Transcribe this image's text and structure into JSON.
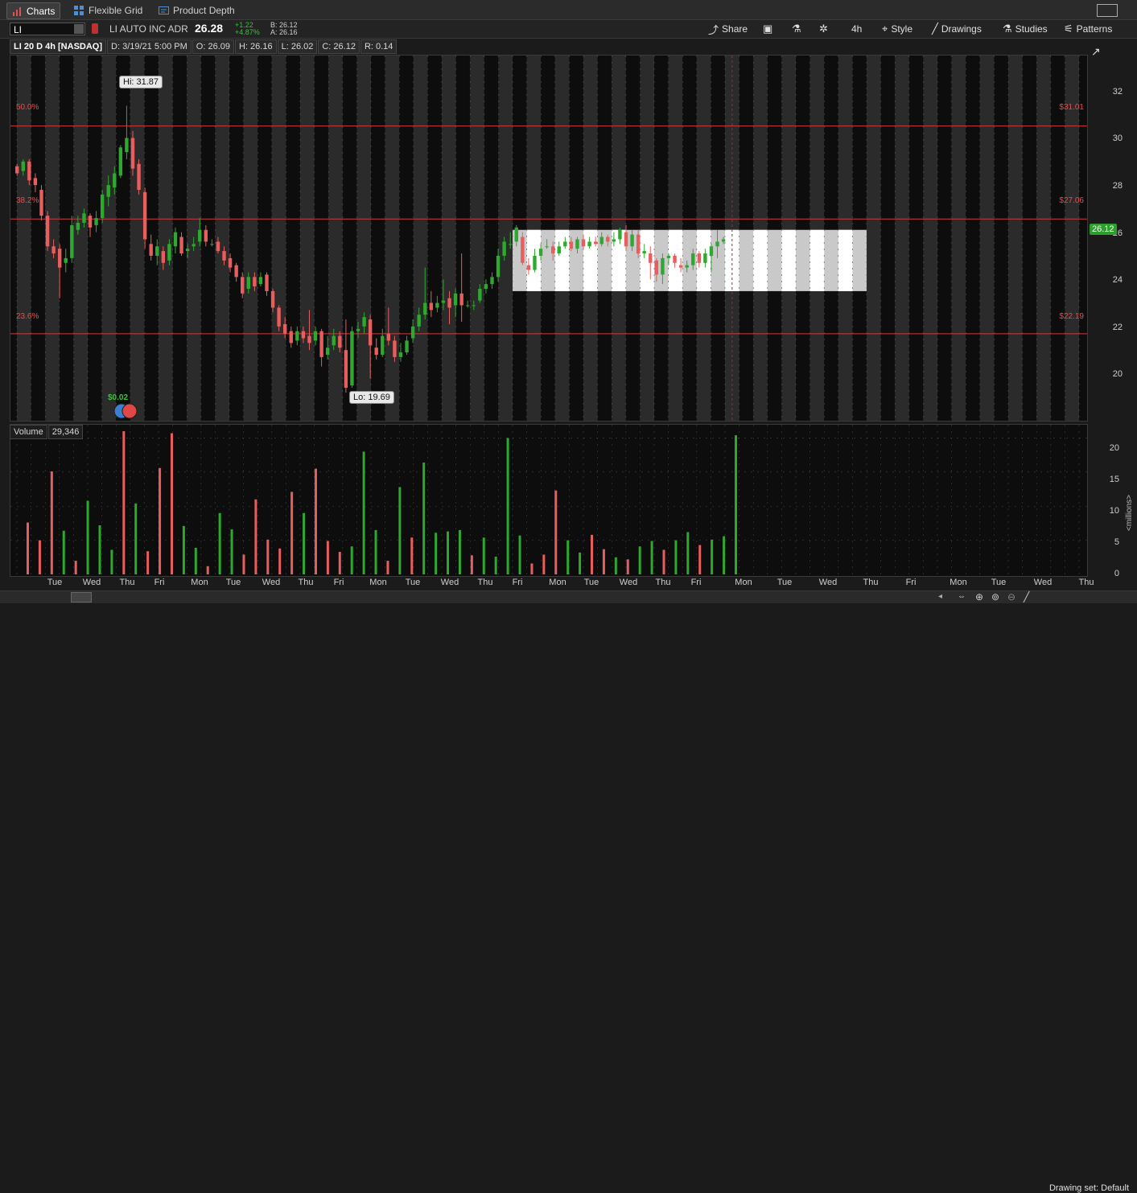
{
  "tabs": [
    {
      "label": "Charts",
      "icon": "bar-chart-icon"
    },
    {
      "label": "Flexible Grid",
      "icon": "grid-icon"
    },
    {
      "label": "Product Depth",
      "icon": "depth-icon"
    }
  ],
  "symbol": {
    "ticker": "LI",
    "company": "LI AUTO INC ADR",
    "last": "26.28",
    "change": "+1.22",
    "change_pct": "+4.87%",
    "bid": "B: 26.12",
    "ask": "A: 26.16"
  },
  "toolbar": {
    "share": "Share",
    "interval": "4h",
    "style": "Style",
    "drawings": "Drawings",
    "studies": "Studies",
    "patterns": "Patterns"
  },
  "header": {
    "symbol": "LI 20 D 4h [NASDAQ]",
    "date": "D: 3/19/21 5:00 PM",
    "open": "O: 26.09",
    "high": "H: 26.16",
    "low": "L: 26.02",
    "close": "C: 26.12",
    "range": "R: 0.14"
  },
  "price_axis": {
    "ticks": [
      "32",
      "30",
      "28",
      "26",
      "24",
      "22",
      "20"
    ],
    "last_tag": "26.12"
  },
  "fib": [
    {
      "pct": "50.0%",
      "price": "$31.01",
      "value": 31.01
    },
    {
      "pct": "38.2%",
      "price": "$27.06",
      "value": 27.06
    },
    {
      "pct": "23.6%",
      "price": "$22.19",
      "value": 22.19
    }
  ],
  "annotations": {
    "hi": "Hi: 31.87",
    "lo": "Lo: 19.69",
    "dividend": "$0.02"
  },
  "volume": {
    "label": "Volume",
    "value": "29,346",
    "axis_ticks": [
      "20",
      "15",
      "10",
      "5",
      "0"
    ],
    "unit": "<millions>"
  },
  "x_axis": [
    "Tue",
    "Wed",
    "Thu",
    "Fri",
    "Mon",
    "Tue",
    "Wed",
    "Thu",
    "Fri",
    "Mon",
    "Tue",
    "Wed",
    "Thu",
    "Fri",
    "Mon",
    "Tue",
    "Wed",
    "Thu",
    "Fri",
    "Mon",
    "Tue",
    "Wed",
    "Thu",
    "Fri",
    "Mon",
    "Tue",
    "Wed",
    "Thu"
  ],
  "bottom": {
    "drawing_set": "Drawing set: Default"
  },
  "colors": {
    "up": "#2ea82e",
    "down": "#e85d5d",
    "fib": "#d23a3a",
    "background": "#0d0d0d"
  },
  "chart_data": {
    "type": "candlestick",
    "interval": "4h",
    "ylim": [
      18.5,
      34
    ],
    "volume_ylim": [
      0,
      21
    ],
    "candles": [
      [
        29.3,
        29.0,
        29.4,
        28.9
      ],
      [
        29.1,
        29.5,
        29.6,
        28.9
      ],
      [
        29.5,
        28.7,
        29.6,
        28.5
      ],
      [
        28.8,
        28.5,
        29.0,
        28.2
      ],
      [
        28.3,
        27.2,
        28.5,
        27.0
      ],
      [
        27.2,
        25.9,
        27.4,
        25.7
      ],
      [
        25.9,
        25.6,
        26.2,
        25.4
      ],
      [
        25.8,
        25.0,
        26.0,
        23.7
      ],
      [
        25.2,
        25.4,
        25.8,
        24.8
      ],
      [
        25.4,
        26.8,
        27.2,
        25.2
      ],
      [
        26.6,
        26.9,
        27.2,
        26.4
      ],
      [
        26.9,
        27.3,
        27.5,
        26.7
      ],
      [
        27.2,
        26.7,
        27.3,
        26.3
      ],
      [
        26.8,
        27.1,
        27.4,
        26.5
      ],
      [
        27.1,
        28.1,
        28.3,
        26.9
      ],
      [
        28.0,
        28.5,
        28.9,
        27.6
      ],
      [
        28.4,
        29.0,
        29.3,
        28.1
      ],
      [
        28.9,
        30.1,
        30.2,
        28.8
      ],
      [
        29.9,
        30.5,
        31.87,
        29.6
      ],
      [
        30.5,
        29.2,
        30.8,
        28.9
      ],
      [
        29.4,
        28.3,
        29.6,
        28.1
      ],
      [
        28.2,
        26.2,
        28.4,
        25.8
      ],
      [
        26.0,
        25.5,
        26.4,
        25.3
      ],
      [
        25.5,
        25.9,
        26.2,
        25.1
      ],
      [
        25.7,
        25.2,
        25.9,
        24.9
      ],
      [
        25.3,
        26.0,
        26.2,
        25.1
      ],
      [
        25.9,
        26.5,
        26.7,
        25.6
      ],
      [
        26.3,
        25.6,
        26.5,
        25.5
      ],
      [
        25.7,
        25.8,
        26.0,
        25.4
      ],
      [
        25.9,
        26.0,
        26.3,
        25.7
      ],
      [
        26.1,
        26.6,
        27.1,
        25.9
      ],
      [
        26.6,
        26.1,
        26.8,
        25.9
      ],
      [
        26.0,
        26.0,
        26.2,
        25.9
      ],
      [
        26.1,
        25.7,
        26.3,
        25.6
      ],
      [
        25.7,
        25.3,
        25.9,
        25.1
      ],
      [
        25.4,
        25.0,
        25.6,
        24.8
      ],
      [
        25.1,
        24.6,
        25.2,
        24.4
      ],
      [
        24.6,
        23.9,
        24.8,
        23.7
      ],
      [
        24.1,
        24.6,
        24.8,
        23.9
      ],
      [
        24.6,
        24.2,
        24.8,
        24.0
      ],
      [
        24.3,
        24.6,
        24.8,
        24.2
      ],
      [
        24.7,
        24.0,
        24.8,
        23.8
      ],
      [
        24.0,
        23.3,
        24.1,
        23.1
      ],
      [
        23.3,
        22.5,
        23.4,
        22.3
      ],
      [
        22.6,
        22.2,
        22.9,
        22.0
      ],
      [
        22.3,
        21.8,
        22.5,
        21.6
      ],
      [
        21.9,
        22.3,
        22.5,
        21.7
      ],
      [
        22.3,
        22.0,
        22.5,
        21.8
      ],
      [
        22.1,
        21.8,
        23.2,
        21.5
      ],
      [
        21.9,
        22.3,
        22.5,
        21.7
      ],
      [
        22.3,
        21.2,
        22.4,
        20.8
      ],
      [
        21.3,
        21.6,
        22.1,
        21.1
      ],
      [
        21.7,
        22.1,
        22.4,
        21.5
      ],
      [
        22.1,
        21.6,
        22.3,
        21.4
      ],
      [
        21.5,
        19.9,
        22.8,
        19.69
      ],
      [
        20.0,
        22.3,
        22.5,
        19.9
      ],
      [
        22.3,
        22.4,
        22.7,
        22.0
      ],
      [
        22.5,
        22.9,
        23.1,
        22.2
      ],
      [
        22.8,
        21.7,
        23.0,
        20.3
      ],
      [
        21.6,
        21.3,
        22.0,
        21.1
      ],
      [
        21.3,
        22.1,
        22.4,
        21.2
      ],
      [
        22.2,
        21.9,
        23.3,
        21.7
      ],
      [
        21.9,
        21.2,
        22.1,
        21.0
      ],
      [
        21.2,
        21.4,
        21.8,
        21.0
      ],
      [
        21.4,
        21.9,
        22.1,
        21.3
      ],
      [
        22.0,
        22.5,
        22.8,
        21.8
      ],
      [
        22.5,
        23.0,
        23.3,
        22.3
      ],
      [
        23.0,
        23.5,
        25.0,
        22.8
      ],
      [
        23.5,
        23.2,
        24.0,
        22.9
      ],
      [
        23.3,
        23.5,
        23.8,
        23.1
      ],
      [
        23.5,
        23.6,
        24.5,
        23.2
      ],
      [
        23.7,
        23.3,
        24.0,
        22.6
      ],
      [
        23.4,
        23.9,
        24.1,
        22.9
      ],
      [
        23.9,
        23.4,
        25.6,
        22.7
      ],
      [
        23.4,
        23.4,
        23.6,
        23.3
      ],
      [
        23.4,
        23.4,
        23.6,
        23.2
      ],
      [
        23.6,
        24.1,
        24.3,
        23.5
      ],
      [
        24.1,
        24.3,
        24.5,
        23.9
      ],
      [
        24.3,
        24.6,
        24.8,
        24.1
      ],
      [
        24.6,
        25.5,
        25.8,
        24.4
      ],
      [
        25.5,
        26.1,
        26.3,
        25.3
      ],
      [
        26.0,
        26.0,
        26.5,
        25.8
      ],
      [
        26.1,
        26.7,
        26.8,
        25.9
      ],
      [
        26.3,
        25.2,
        26.5,
        25.1
      ],
      [
        25.1,
        24.9,
        25.4,
        24.7
      ],
      [
        24.9,
        25.5,
        25.8,
        24.8
      ],
      [
        25.5,
        25.8,
        26.0,
        25.3
      ],
      [
        25.9,
        25.9,
        26.2,
        25.8
      ],
      [
        25.9,
        25.6,
        26.1,
        25.3
      ],
      [
        25.6,
        25.9,
        26.1,
        25.5
      ],
      [
        25.9,
        26.1,
        26.3,
        25.8
      ],
      [
        26.1,
        25.8,
        26.3,
        25.7
      ],
      [
        25.8,
        26.2,
        26.3,
        25.6
      ],
      [
        26.2,
        25.9,
        26.4,
        25.8
      ],
      [
        25.9,
        26.1,
        26.3,
        25.8
      ],
      [
        26.1,
        26.0,
        26.3,
        25.9
      ],
      [
        26.0,
        26.3,
        26.5,
        25.9
      ],
      [
        26.3,
        26.1,
        26.4,
        25.9
      ],
      [
        26.1,
        26.2,
        26.5,
        25.9
      ],
      [
        26.2,
        26.6,
        26.7,
        26.0
      ],
      [
        26.5,
        25.9,
        26.8,
        25.7
      ],
      [
        25.9,
        26.4,
        26.6,
        25.7
      ],
      [
        26.4,
        25.6,
        26.6,
        25.4
      ],
      [
        25.6,
        25.7,
        26.0,
        25.4
      ],
      [
        25.6,
        25.2,
        25.9,
        24.5
      ],
      [
        25.3,
        24.7,
        25.4,
        24.4
      ],
      [
        24.7,
        25.4,
        25.6,
        24.3
      ],
      [
        25.4,
        25.5,
        25.6,
        25.1
      ],
      [
        25.5,
        25.2,
        25.6,
        25.0
      ],
      [
        25.1,
        25.0,
        25.4,
        24.8
      ],
      [
        25.0,
        25.1,
        25.3,
        24.8
      ],
      [
        25.1,
        25.6,
        25.8,
        24.9
      ],
      [
        25.6,
        25.2,
        25.7,
        25.0
      ],
      [
        25.2,
        25.6,
        25.8,
        25.0
      ],
      [
        25.5,
        25.9,
        26.0,
        24.8
      ],
      [
        25.9,
        26.1,
        26.6,
        25.4
      ],
      [
        26.1,
        26.2,
        26.3,
        26.0
      ]
    ],
    "volume_millions": [
      7.6,
      5.0,
      15.1,
      6.4,
      2.0,
      10.8,
      7.2,
      3.6,
      21.0,
      10.4,
      3.4,
      15.6,
      20.7,
      7.1,
      3.9,
      1.2,
      9.0,
      6.6,
      2.9,
      11.0,
      5.1,
      3.8,
      12.1,
      9.0,
      15.5,
      4.9,
      3.3,
      4.1,
      18.0,
      6.5,
      2.0,
      12.8,
      5.4,
      16.4,
      6.1,
      6.3,
      6.5,
      2.8,
      5.4,
      2.6,
      20.0,
      5.7,
      1.6,
      2.9,
      12.3,
      5.0,
      3.2,
      5.8,
      3.7,
      2.5,
      2.2,
      4.1,
      4.9,
      3.6,
      5.0,
      6.2,
      4.3,
      5.1,
      5.6,
      20.4
    ],
    "volume_up": [
      false,
      false,
      false,
      true,
      false,
      true,
      true,
      true,
      false,
      true,
      false,
      false,
      false,
      true,
      true,
      false,
      true,
      true,
      false,
      false,
      false,
      false,
      false,
      true,
      false,
      false,
      false,
      true,
      true,
      true,
      false,
      true,
      false,
      true,
      true,
      true,
      true,
      false,
      true,
      true,
      true,
      true,
      false,
      false,
      false,
      true,
      true,
      false,
      false,
      true,
      false,
      true,
      true,
      false,
      true,
      true,
      false,
      true,
      true,
      true
    ]
  }
}
